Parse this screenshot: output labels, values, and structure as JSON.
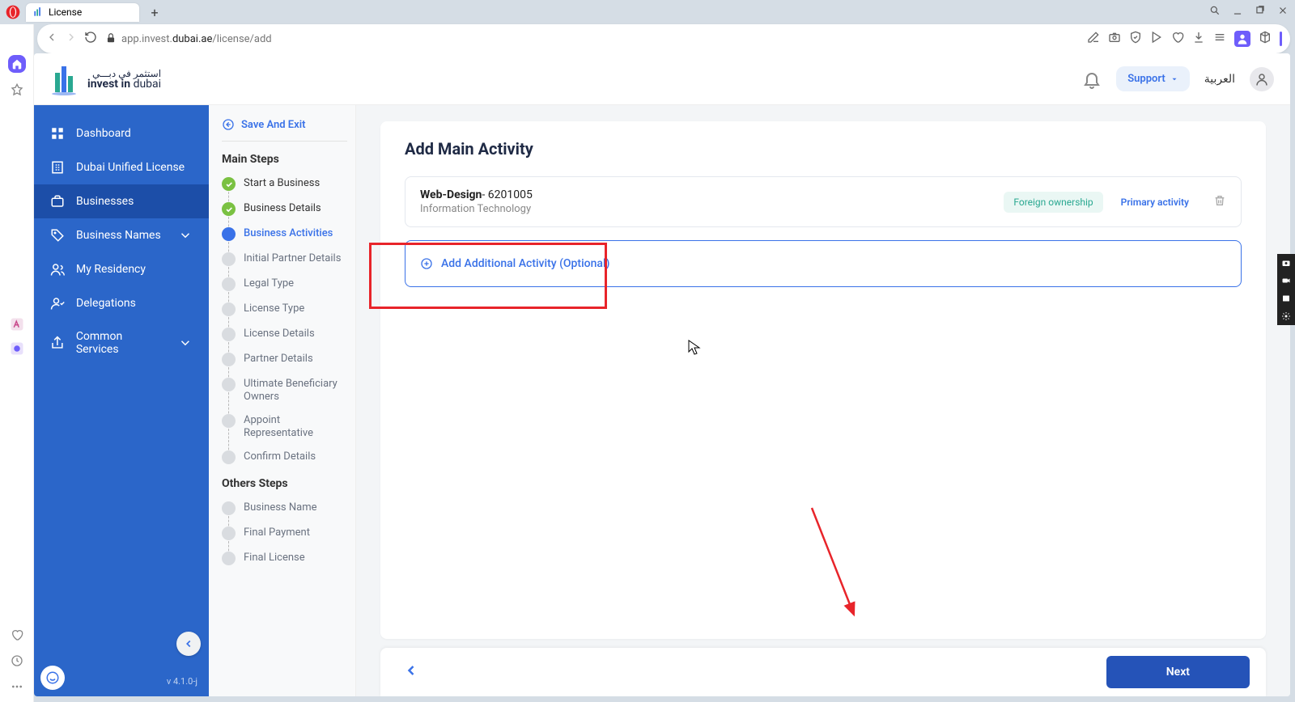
{
  "browser": {
    "tab_title": "License",
    "url_prefix": "app.invest.",
    "url_domain": "dubai.ae",
    "url_path": "/license/add"
  },
  "header": {
    "logo_ar": "استثمر في دبـــي",
    "logo_en_1": "invest in ",
    "logo_en_2": "dubai",
    "support": "Support",
    "lang": "العربية"
  },
  "sidebar": {
    "items": [
      {
        "label": "Dashboard"
      },
      {
        "label": "Dubai Unified License"
      },
      {
        "label": "Businesses"
      },
      {
        "label": "Business Names"
      },
      {
        "label": "My Residency"
      },
      {
        "label": "Delegations"
      },
      {
        "label": "Common Services"
      }
    ],
    "version": "v 4.1.0-j"
  },
  "steps": {
    "save_exit": "Save And Exit",
    "main_heading": "Main Steps",
    "main": [
      {
        "label": "Start a Business",
        "state": "done"
      },
      {
        "label": "Business Details",
        "state": "done"
      },
      {
        "label": "Business Activities",
        "state": "current"
      },
      {
        "label": "Initial Partner Details",
        "state": "pending"
      },
      {
        "label": "Legal Type",
        "state": "pending"
      },
      {
        "label": "License Type",
        "state": "pending"
      },
      {
        "label": "License Details",
        "state": "pending"
      },
      {
        "label": "Partner Details",
        "state": "pending"
      },
      {
        "label": "Ultimate Beneficiary Owners",
        "state": "pending"
      },
      {
        "label": "Appoint Representative",
        "state": "pending"
      },
      {
        "label": "Confirm Details",
        "state": "pending"
      }
    ],
    "others_heading": "Others Steps",
    "others": [
      {
        "label": "Business Name",
        "state": "pending"
      },
      {
        "label": "Final Payment",
        "state": "pending"
      },
      {
        "label": "Final License",
        "state": "pending"
      }
    ]
  },
  "main": {
    "title": "Add Main Activity",
    "activity": {
      "name": "Web-Design",
      "code": "- 6201005",
      "category": "Information Technology",
      "tag1": "Foreign ownership",
      "tag2": "Primary activity"
    },
    "add_label": "Add Additional Activity (Optional)",
    "next": "Next"
  }
}
